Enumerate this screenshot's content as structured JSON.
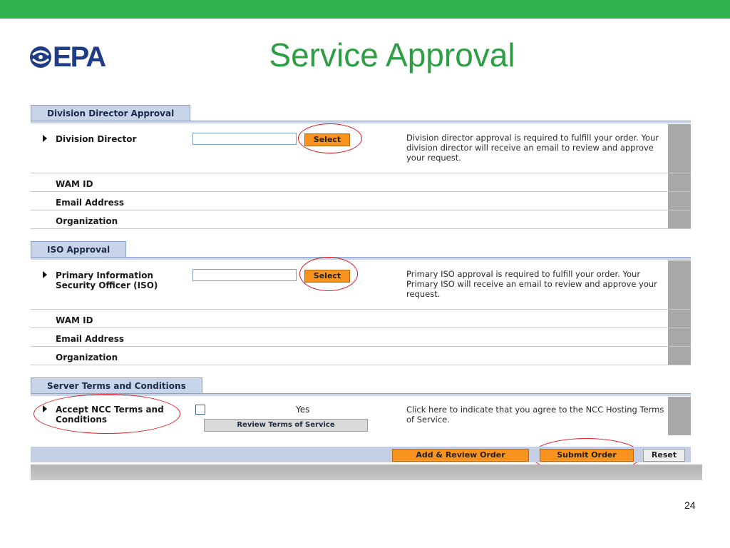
{
  "slide": {
    "logo_text": "EPA",
    "title": "Service Approval",
    "page_number": "24"
  },
  "division_section": {
    "tab_label": "Division Director Approval",
    "field_label": "Division Director",
    "select_label": "Select",
    "description": "Division director approval is required to fulfill your order. Your division director will receive an email to review and approve your request.",
    "wam_label": "WAM ID",
    "email_label": "Email Address",
    "org_label": "Organization"
  },
  "iso_section": {
    "tab_label": "ISO Approval",
    "field_label": "Primary Information Security Officer (ISO)",
    "select_label": "Select",
    "description": "Primary ISO approval is required to fulfill your order. Your Primary ISO will receive an email to review and approve your request.",
    "wam_label": "WAM ID",
    "email_label": "Email Address",
    "org_label": "Organization"
  },
  "terms_section": {
    "tab_label": "Server Terms and Conditions",
    "field_label": "Accept NCC Terms and Conditions",
    "yes_label": "Yes",
    "review_button": "Review Terms of Service",
    "description": "Click here to indicate that you agree to the NCC Hosting Terms of Service."
  },
  "actions": {
    "add_review": "Add & Review Order",
    "submit": "Submit Order",
    "reset": "Reset"
  },
  "colors": {
    "accent_green": "#2db24c",
    "title_green": "#2e9e44",
    "button_orange": "#f7931e",
    "highlight_red": "#e0171e"
  }
}
